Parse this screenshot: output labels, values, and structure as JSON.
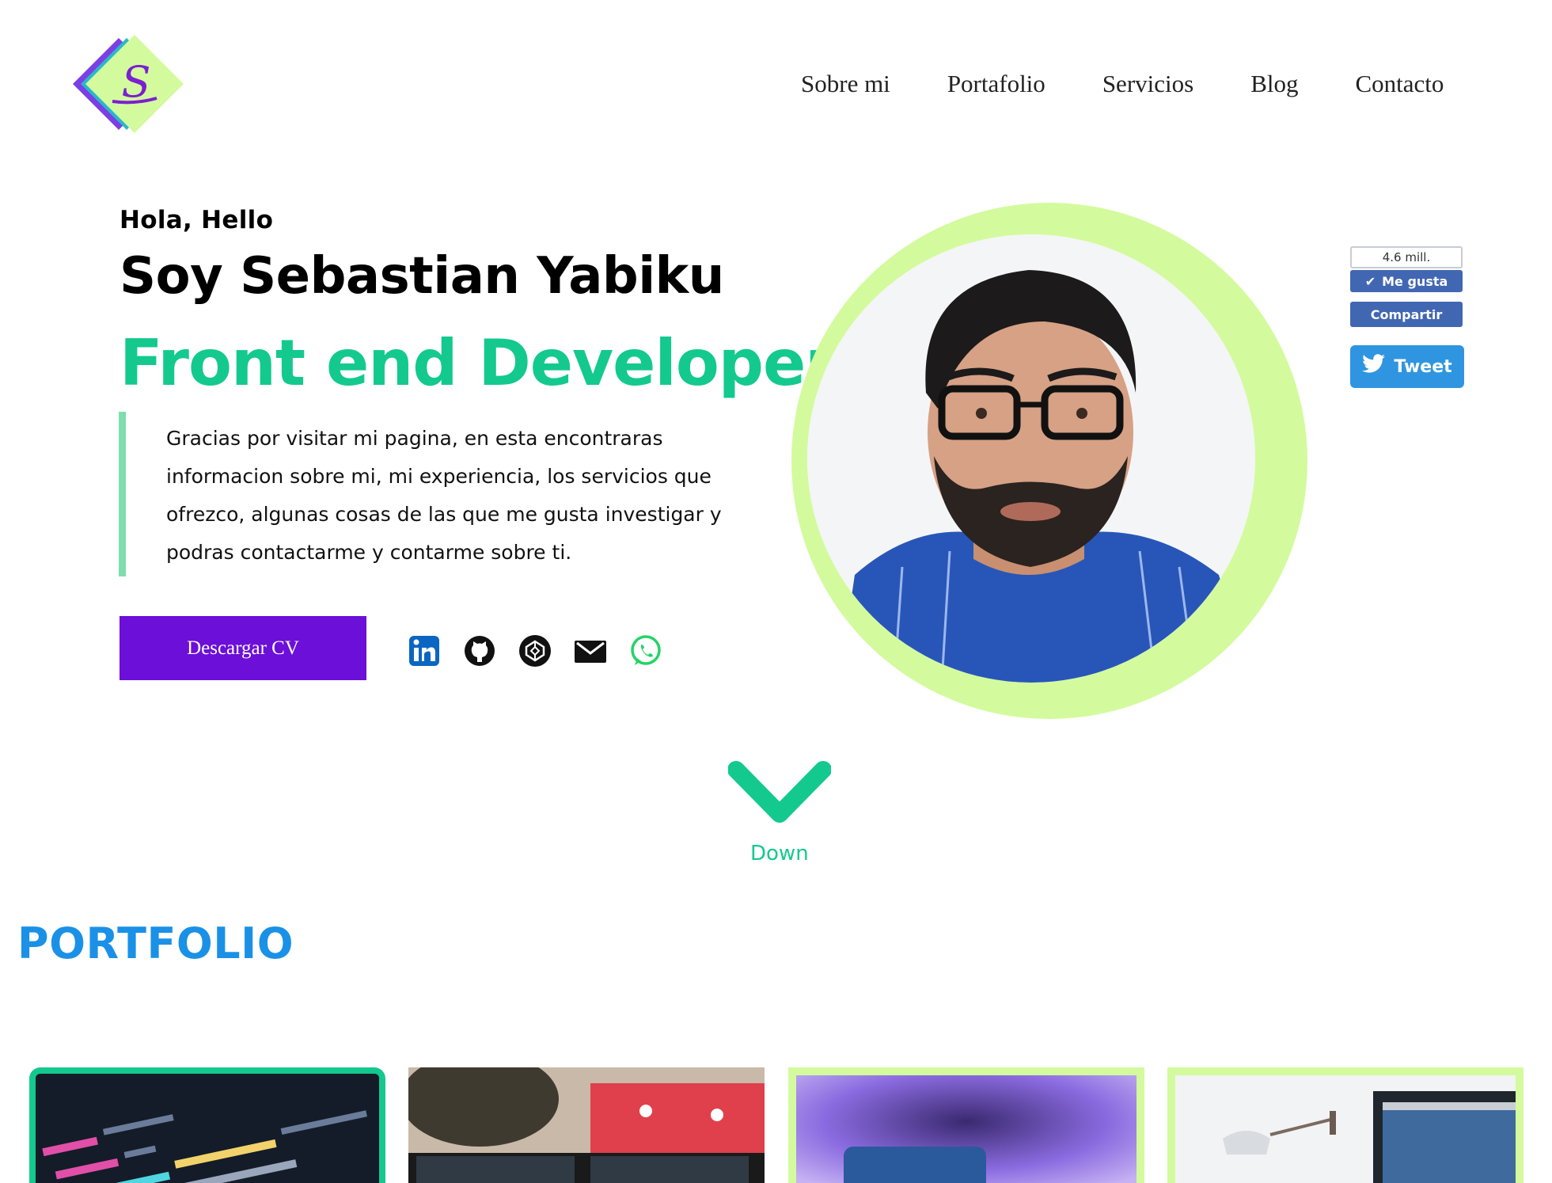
{
  "header": {
    "logo_letter": "S",
    "nav": [
      "Sobre mi",
      "Portafolio",
      "Servicios",
      "Blog",
      "Contacto"
    ]
  },
  "hero": {
    "greeting": "Hola, Hello",
    "name": "Soy Sebastian Yabiku",
    "role": "Front end Developer",
    "intro": "Gracias por visitar mi pagina, en esta encontraras informacion sobre mi, mi experiencia, los servicios que ofrezco, algunas cosas de las que me gusta investigar y podras contactarme y contarme sobre ti.",
    "cv_button": "Descargar CV",
    "socials": [
      "linkedin-icon",
      "github-icon",
      "codepen-icon",
      "email-icon",
      "whatsapp-icon"
    ]
  },
  "widgets": {
    "fb_count": "4.6 mill.",
    "fb_like": "Me gusta",
    "fb_share": "Compartir",
    "tweet": "Tweet"
  },
  "scroll": {
    "down_label": "Down"
  },
  "portfolio": {
    "title": "PORTFOLIO"
  },
  "colors": {
    "accent_green": "#14c98e",
    "light_green": "#d3fb9e",
    "purple": "#6c0fd8",
    "blue_title": "#1a91e6"
  }
}
